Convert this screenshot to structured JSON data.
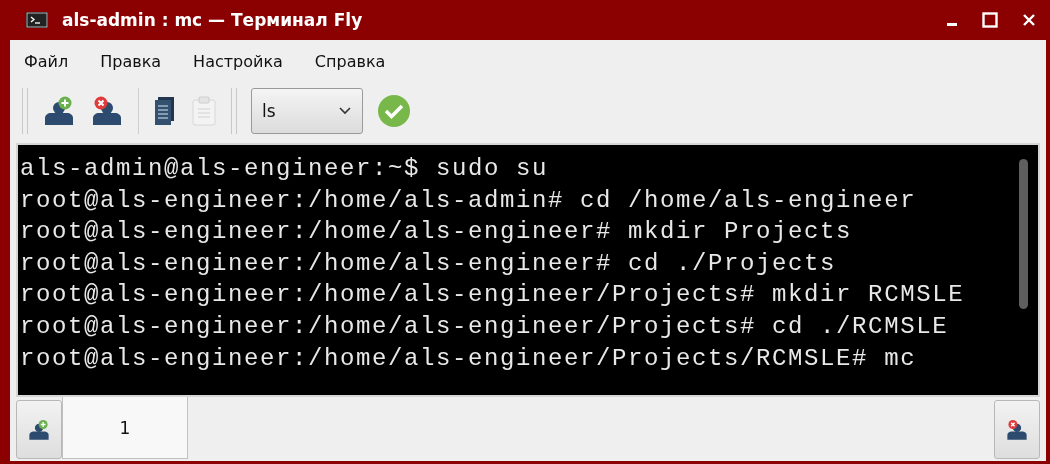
{
  "window": {
    "title": "als-admin : mc — Терминал Fly"
  },
  "menu": [
    "Файл",
    "Правка",
    "Настройка",
    "Справка"
  ],
  "toolbar": {
    "command": {
      "value": "ls"
    }
  },
  "terminal": {
    "lines": [
      "als-admin@als-engineer:~$ sudo su",
      "root@als-engineer:/home/als-admin# cd /home/als-engineer",
      "root@als-engineer:/home/als-engineer# mkdir Projects",
      "root@als-engineer:/home/als-engineer# cd ./Projects",
      "root@als-engineer:/home/als-engineer/Projects# mkdir RCMSLE",
      "root@als-engineer:/home/als-engineer/Projects# cd ./RCMSLE",
      "root@als-engineer:/home/als-engineer/Projects/RCMSLE# mc"
    ]
  },
  "tabs": [
    {
      "label": "1",
      "selected": true
    }
  ]
}
